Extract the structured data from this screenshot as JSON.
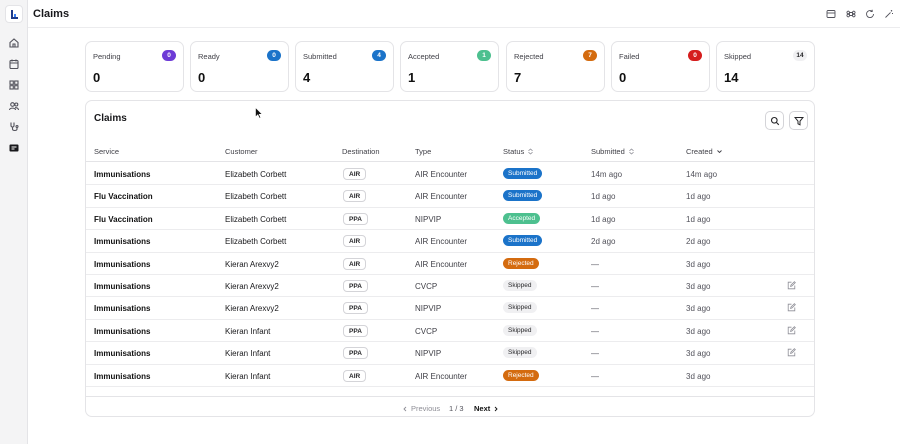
{
  "header": {
    "title": "Claims"
  },
  "sidebar": {
    "items": [
      {
        "icon": "home-icon"
      },
      {
        "icon": "calendar-icon"
      },
      {
        "icon": "grid-icon"
      },
      {
        "icon": "users-icon"
      },
      {
        "icon": "stethoscope-icon"
      },
      {
        "icon": "claims-icon",
        "active": true
      }
    ]
  },
  "top_actions": [
    {
      "icon": "layout-icon"
    },
    {
      "icon": "command-icon"
    },
    {
      "icon": "refresh-icon"
    },
    {
      "icon": "wand-icon"
    }
  ],
  "stats": [
    {
      "label": "Pending",
      "badge": "0",
      "value": "0",
      "color": "#6d3bd6"
    },
    {
      "label": "Ready",
      "badge": "0",
      "value": "0",
      "color": "#1b73c9"
    },
    {
      "label": "Submitted",
      "badge": "4",
      "value": "4",
      "color": "#1b73c9"
    },
    {
      "label": "Accepted",
      "badge": "1",
      "value": "1",
      "color": "#4dc08f"
    },
    {
      "label": "Rejected",
      "badge": "7",
      "value": "7",
      "color": "#d46b0f"
    },
    {
      "label": "Failed",
      "badge": "0",
      "value": "0",
      "color": "#d51d1d"
    },
    {
      "label": "Skipped",
      "badge": "14",
      "value": "14",
      "color": "#f0f0f2"
    }
  ],
  "table": {
    "title": "Claims",
    "columns": [
      "Service",
      "Customer",
      "Destination",
      "Type",
      "Status",
      "Submitted",
      "Created"
    ],
    "rows": [
      {
        "service": "Immunisations",
        "customer": "Elizabeth Corbett",
        "destination": "AIR",
        "type": "AIR Encounter",
        "status": "Submitted",
        "submitted": "14m ago",
        "created": "14m ago",
        "editable": false
      },
      {
        "service": "Flu Vaccination",
        "customer": "Elizabeth Corbett",
        "destination": "AIR",
        "type": "AIR Encounter",
        "status": "Submitted",
        "submitted": "1d ago",
        "created": "1d ago",
        "editable": false
      },
      {
        "service": "Flu Vaccination",
        "customer": "Elizabeth Corbett",
        "destination": "PPA",
        "type": "NIPVIP",
        "status": "Accepted",
        "submitted": "1d ago",
        "created": "1d ago",
        "editable": false
      },
      {
        "service": "Immunisations",
        "customer": "Elizabeth Corbett",
        "destination": "AIR",
        "type": "AIR Encounter",
        "status": "Submitted",
        "submitted": "2d ago",
        "created": "2d ago",
        "editable": false
      },
      {
        "service": "Immunisations",
        "customer": "Kieran Arexvy2",
        "destination": "AIR",
        "type": "AIR Encounter",
        "status": "Rejected",
        "submitted": "—",
        "created": "3d ago",
        "editable": false
      },
      {
        "service": "Immunisations",
        "customer": "Kieran Arexvy2",
        "destination": "PPA",
        "type": "CVCP",
        "status": "Skipped",
        "submitted": "—",
        "created": "3d ago",
        "editable": true
      },
      {
        "service": "Immunisations",
        "customer": "Kieran Arexvy2",
        "destination": "PPA",
        "type": "NIPVIP",
        "status": "Skipped",
        "submitted": "—",
        "created": "3d ago",
        "editable": true
      },
      {
        "service": "Immunisations",
        "customer": "Kieran Infant",
        "destination": "PPA",
        "type": "CVCP",
        "status": "Skipped",
        "submitted": "—",
        "created": "3d ago",
        "editable": true
      },
      {
        "service": "Immunisations",
        "customer": "Kieran Infant",
        "destination": "PPA",
        "type": "NIPVIP",
        "status": "Skipped",
        "submitted": "—",
        "created": "3d ago",
        "editable": true
      },
      {
        "service": "Immunisations",
        "customer": "Kieran Infant",
        "destination": "AIR",
        "type": "AIR Encounter",
        "status": "Rejected",
        "submitted": "—",
        "created": "3d ago",
        "editable": false
      }
    ]
  },
  "status_colors": {
    "Submitted": {
      "bg": "#1b73c9",
      "fg": "#ffffff"
    },
    "Accepted": {
      "bg": "#4dc08f",
      "fg": "#ffffff"
    },
    "Rejected": {
      "bg": "#d46b0f",
      "fg": "#ffffff"
    },
    "Skipped": {
      "bg": "#f0f0f2",
      "fg": "#27272a"
    }
  },
  "pagination": {
    "prev": "Previous",
    "page": "1 / 3",
    "next": "Next"
  }
}
